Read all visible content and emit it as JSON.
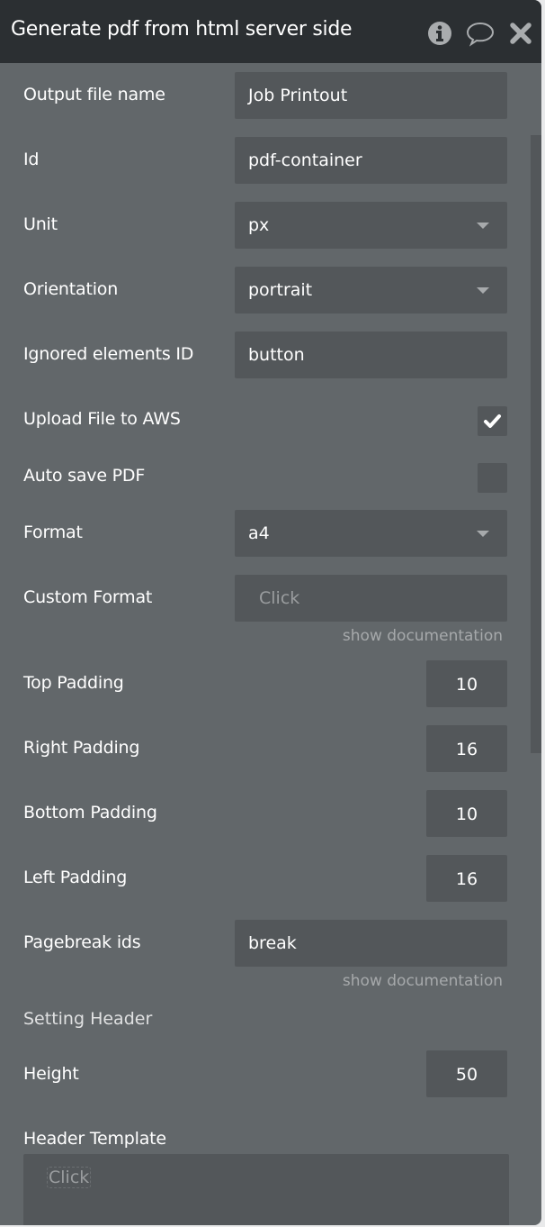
{
  "header": {
    "title": "Generate pdf from html server side",
    "icons": [
      "info-icon",
      "comment-icon",
      "close-icon"
    ]
  },
  "fields": {
    "output_file_name": {
      "label": "Output file name",
      "value": "Job Printout"
    },
    "id": {
      "label": "Id",
      "value": "pdf-container"
    },
    "unit": {
      "label": "Unit",
      "value": "px"
    },
    "orientation": {
      "label": "Orientation",
      "value": "portrait"
    },
    "ignored": {
      "label": "Ignored elements ID",
      "value": "button"
    },
    "upload_aws": {
      "label": "Upload File to AWS",
      "checked": true
    },
    "auto_save": {
      "label": "Auto save PDF",
      "checked": false
    },
    "format": {
      "label": "Format",
      "value": "a4"
    },
    "custom_format": {
      "label": "Custom Format",
      "placeholder": "Click",
      "doc_link": "show documentation"
    },
    "top_padding": {
      "label": "Top Padding",
      "value": "10"
    },
    "right_padding": {
      "label": "Right Padding",
      "value": "16"
    },
    "bottom_padding": {
      "label": "Bottom Padding",
      "value": "10"
    },
    "left_padding": {
      "label": "Left Padding",
      "value": "16"
    },
    "pagebreak": {
      "label": "Pagebreak ids",
      "value": "break",
      "doc_link": "show documentation"
    },
    "setting_header": "Setting Header",
    "height": {
      "label": "Height",
      "value": "50"
    },
    "header_template": {
      "label": "Header Template",
      "placeholder": "Click"
    }
  }
}
